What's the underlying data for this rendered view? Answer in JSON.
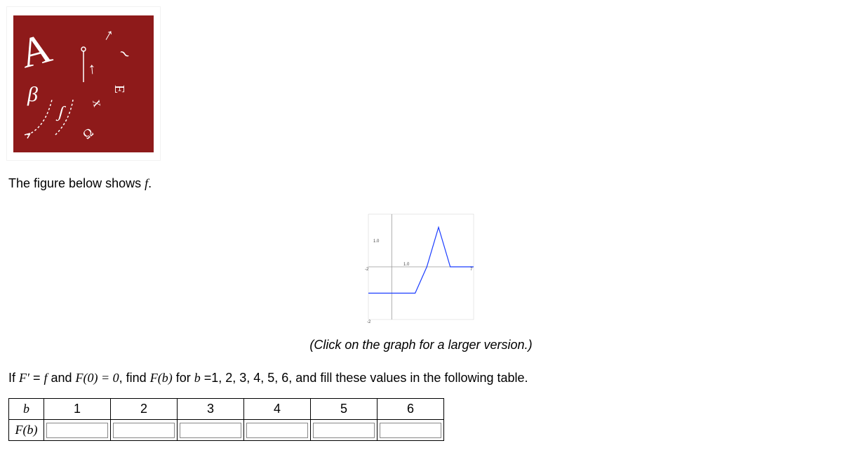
{
  "header_image_alt": "Mathematical symbols collage",
  "figure_intro_pre": "The figure below shows ",
  "figure_intro_fn": "f",
  "figure_intro_post": ".",
  "graph_caption": "(Click on the graph for a larger version.)",
  "question": {
    "pre": "If ",
    "Fprime": "F′",
    "eq1": " = ",
    "f": "f",
    "and": " and ",
    "F0": "F(0) = 0",
    "mid": ", find ",
    "Fb": "F(b)",
    "for": " for ",
    "b": "b",
    "eq": " =",
    "vals": "1, 2, 3, 4, 5, 6, and fill these values in the following table."
  },
  "table": {
    "row1_label": "b",
    "row2_label": "F(b)",
    "headers": [
      "1",
      "2",
      "3",
      "4",
      "5",
      "6"
    ],
    "inputs": [
      "",
      "",
      "",
      "",
      "",
      ""
    ]
  },
  "chart_data": {
    "type": "line",
    "title": "",
    "xlabel": "",
    "ylabel": "",
    "xlim": [
      -2,
      7
    ],
    "ylim": [
      -2,
      2
    ],
    "xticks": [
      -2,
      1,
      7
    ],
    "yticks": [
      -2,
      1
    ],
    "xtick_labels": [
      "-2",
      "1.0",
      "7"
    ],
    "ytick_labels": [
      "-2",
      "1.0"
    ],
    "series": [
      {
        "name": "f",
        "color": "#1a3cff",
        "x": [
          -2,
          0,
          2,
          3,
          4,
          5,
          7
        ],
        "y": [
          -1,
          -1,
          -1,
          0,
          1.5,
          0,
          0
        ]
      }
    ]
  }
}
